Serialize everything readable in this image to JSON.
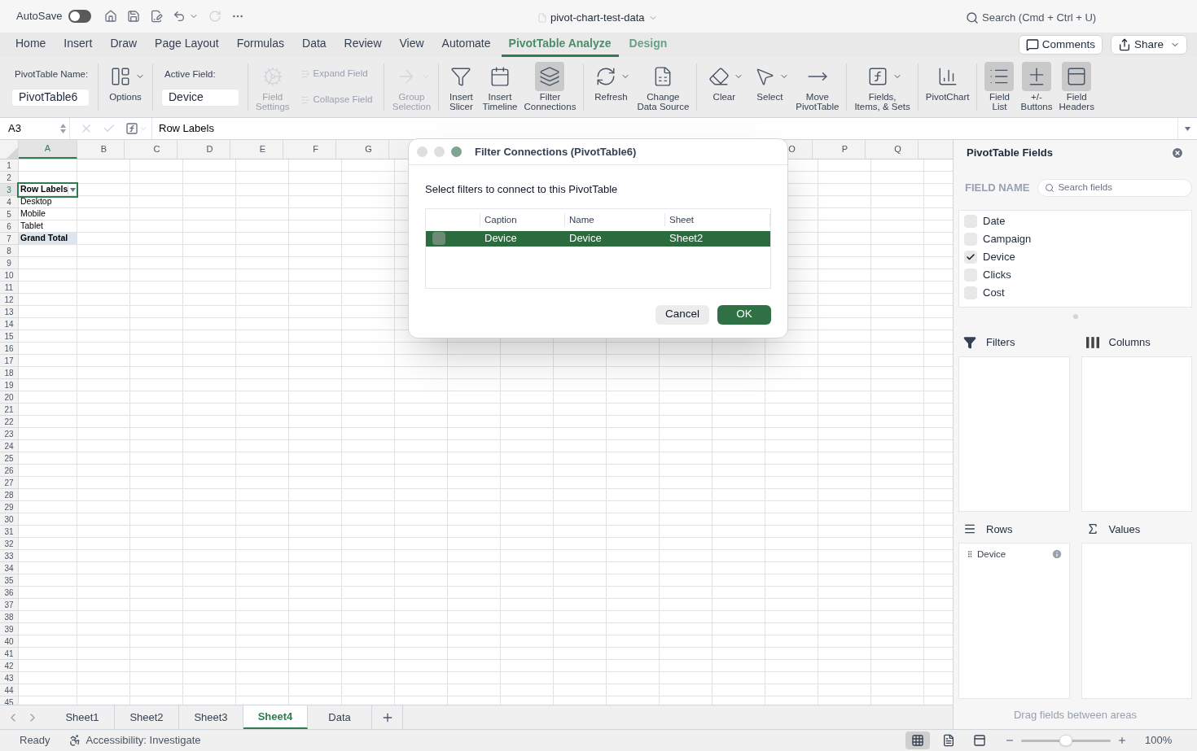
{
  "title_bar": {
    "autosave_label": "AutoSave",
    "autosave_on": false,
    "document_title": "pivot-chart-test-data",
    "search_placeholder": "Search (Cmd + Ctrl + U)"
  },
  "ribbon_tabs": [
    {
      "label": "Home",
      "selected": false,
      "contextual": false
    },
    {
      "label": "Insert",
      "selected": false,
      "contextual": false
    },
    {
      "label": "Draw",
      "selected": false,
      "contextual": false
    },
    {
      "label": "Page Layout",
      "selected": false,
      "contextual": false
    },
    {
      "label": "Formulas",
      "selected": false,
      "contextual": false
    },
    {
      "label": "Data",
      "selected": false,
      "contextual": false
    },
    {
      "label": "Review",
      "selected": false,
      "contextual": false
    },
    {
      "label": "View",
      "selected": false,
      "contextual": false
    },
    {
      "label": "Automate",
      "selected": false,
      "contextual": false
    },
    {
      "label": "PivotTable Analyze",
      "selected": true,
      "contextual": true
    },
    {
      "label": "Design",
      "selected": false,
      "contextual": true
    }
  ],
  "header_buttons": [
    "Comments",
    "Share"
  ],
  "ribbon_groups": [
    {
      "kind": "field",
      "label": "PivotTable Name:",
      "value": "PivotTable6"
    },
    {
      "kind": "buttons",
      "buttons": [
        {
          "kind": "large",
          "label": "Options",
          "caret": true,
          "disabled": false,
          "pressed": false
        }
      ]
    },
    {
      "kind": "field",
      "label": "Active Field:",
      "value": "Device"
    },
    {
      "kind": "buttons",
      "buttons": [
        {
          "kind": "large",
          "label": "Field\nSettings",
          "caret": false,
          "disabled": true,
          "pressed": false
        },
        {
          "kind": "small",
          "label": "Expand Field",
          "disabled": true
        },
        {
          "kind": "small",
          "label": "Collapse Field",
          "disabled": true
        }
      ]
    },
    {
      "kind": "buttons",
      "buttons": [
        {
          "kind": "large",
          "label": "Group\nSelection",
          "caret": true,
          "disabled": true,
          "pressed": false
        }
      ]
    },
    {
      "kind": "buttons",
      "buttons": [
        {
          "kind": "large",
          "label": "Insert\nSlicer",
          "caret": false,
          "disabled": false,
          "pressed": false
        },
        {
          "kind": "large",
          "label": "Insert\nTimeline",
          "caret": false,
          "disabled": false,
          "pressed": false
        },
        {
          "kind": "large",
          "label": "Filter\nConnections",
          "caret": false,
          "disabled": false,
          "pressed": true
        }
      ]
    },
    {
      "kind": "buttons",
      "buttons": [
        {
          "kind": "large",
          "label": "Refresh",
          "caret": true,
          "disabled": false,
          "pressed": false
        },
        {
          "kind": "large",
          "label": "Change\nData Source",
          "caret": false,
          "disabled": false,
          "pressed": false
        }
      ]
    },
    {
      "kind": "buttons",
      "buttons": [
        {
          "kind": "large",
          "label": "Clear",
          "caret": true,
          "disabled": false,
          "pressed": false
        },
        {
          "kind": "large",
          "label": "Select",
          "caret": true,
          "disabled": false,
          "pressed": false
        },
        {
          "kind": "large",
          "label": "Move\nPivotTable",
          "caret": false,
          "disabled": false,
          "pressed": false
        }
      ]
    },
    {
      "kind": "buttons",
      "buttons": [
        {
          "kind": "large",
          "label": "Fields,\nItems, & Sets",
          "caret": true,
          "disabled": false,
          "pressed": false
        }
      ]
    },
    {
      "kind": "buttons",
      "buttons": [
        {
          "kind": "large",
          "label": "PivotChart",
          "caret": false,
          "disabled": false,
          "pressed": false
        }
      ]
    },
    {
      "kind": "buttons",
      "buttons": [
        {
          "kind": "large",
          "label": "Field\nList",
          "caret": false,
          "disabled": false,
          "pressed": true
        },
        {
          "kind": "large",
          "label": "+/-\nButtons",
          "caret": false,
          "disabled": false,
          "pressed": true
        },
        {
          "kind": "large",
          "label": "Field\nHeaders",
          "caret": false,
          "disabled": false,
          "pressed": true
        }
      ]
    }
  ],
  "formula_bar": {
    "name_box": "A3",
    "formula": "Row Labels"
  },
  "sheet": {
    "columns_left": [
      {
        "label": "A",
        "selected": true
      },
      {
        "label": "B",
        "selected": false
      },
      {
        "label": "C",
        "selected": false
      },
      {
        "label": "D",
        "selected": false
      },
      {
        "label": "E",
        "selected": false
      },
      {
        "label": "F",
        "selected": false
      },
      {
        "label": "G",
        "selected": false
      }
    ],
    "columns_right": [
      {
        "label": "O",
        "selected": false
      },
      {
        "label": "P",
        "selected": false
      },
      {
        "label": "Q",
        "selected": false
      }
    ],
    "rows": [
      {
        "label": "1",
        "selected": false
      },
      {
        "label": "2",
        "selected": false
      },
      {
        "label": "3",
        "selected": true
      },
      {
        "label": "4",
        "selected": false
      },
      {
        "label": "5",
        "selected": false
      },
      {
        "label": "6",
        "selected": false
      },
      {
        "label": "7",
        "selected": false
      },
      {
        "label": "8",
        "selected": false
      },
      {
        "label": "9",
        "selected": false
      },
      {
        "label": "10",
        "selected": false
      },
      {
        "label": "11",
        "selected": false
      },
      {
        "label": "12",
        "selected": false
      },
      {
        "label": "13",
        "selected": false
      },
      {
        "label": "14",
        "selected": false
      },
      {
        "label": "15",
        "selected": false
      },
      {
        "label": "16",
        "selected": false
      },
      {
        "label": "17",
        "selected": false
      },
      {
        "label": "18",
        "selected": false
      },
      {
        "label": "19",
        "selected": false
      },
      {
        "label": "20",
        "selected": false
      },
      {
        "label": "21",
        "selected": false
      },
      {
        "label": "22",
        "selected": false
      },
      {
        "label": "23",
        "selected": false
      },
      {
        "label": "24",
        "selected": false
      },
      {
        "label": "25",
        "selected": false
      },
      {
        "label": "26",
        "selected": false
      },
      {
        "label": "27",
        "selected": false
      },
      {
        "label": "28",
        "selected": false
      },
      {
        "label": "29",
        "selected": false
      },
      {
        "label": "30",
        "selected": false
      },
      {
        "label": "31",
        "selected": false
      },
      {
        "label": "32",
        "selected": false
      },
      {
        "label": "33",
        "selected": false
      },
      {
        "label": "34",
        "selected": false
      },
      {
        "label": "35",
        "selected": false
      },
      {
        "label": "36",
        "selected": false
      },
      {
        "label": "37",
        "selected": false
      },
      {
        "label": "38",
        "selected": false
      },
      {
        "label": "39",
        "selected": false
      },
      {
        "label": "40",
        "selected": false
      },
      {
        "label": "41",
        "selected": false
      },
      {
        "label": "42",
        "selected": false
      },
      {
        "label": "43",
        "selected": false
      },
      {
        "label": "44",
        "selected": false
      },
      {
        "label": "45",
        "selected": false
      }
    ],
    "pivot_cells": [
      {
        "text": "Row Labels",
        "kind": "header",
        "selected": true
      },
      {
        "text": "Desktop",
        "kind": "item",
        "selected": false
      },
      {
        "text": "Mobile",
        "kind": "item",
        "selected": false
      },
      {
        "text": "Tablet",
        "kind": "item",
        "selected": false
      },
      {
        "text": "Grand Total",
        "kind": "total",
        "selected": false
      }
    ]
  },
  "sheet_tabs": [
    {
      "label": "Sheet1",
      "selected": false
    },
    {
      "label": "Sheet2",
      "selected": false
    },
    {
      "label": "Sheet3",
      "selected": false
    },
    {
      "label": "Sheet4",
      "selected": true
    },
    {
      "label": "Data",
      "selected": false
    }
  ],
  "status_bar": {
    "status": "Ready",
    "accessibility": "Accessibility: Investigate",
    "views": [
      {
        "kind": "normal",
        "selected": true
      },
      {
        "kind": "page_layout",
        "selected": false
      },
      {
        "kind": "page_break",
        "selected": false
      }
    ],
    "zoom": {
      "level": 0.5,
      "reading": "100%"
    }
  },
  "dialog": {
    "title": "Filter Connections (PivotTable6)",
    "prompt": "Select filters to connect to this PivotTable",
    "columns": [
      "Caption",
      "Name",
      "Sheet"
    ],
    "rows": [
      {
        "checked": false,
        "selected": true,
        "cells": [
          "Device",
          "Device",
          "Sheet2"
        ]
      }
    ],
    "buttons": [
      {
        "label": "Cancel",
        "kind": "secondary"
      },
      {
        "label": "OK",
        "kind": "primary"
      }
    ]
  },
  "field_panel": {
    "title": "PivotTable Fields",
    "field_name_label": "FIELD NAME",
    "search_placeholder": "Search fields",
    "fields": [
      {
        "label": "Date",
        "checked": false
      },
      {
        "label": "Campaign",
        "checked": false
      },
      {
        "label": "Device",
        "checked": true
      },
      {
        "label": "Clicks",
        "checked": false
      },
      {
        "label": "Cost",
        "checked": false
      }
    ],
    "areas": [
      {
        "kind": "filters",
        "label": "Filters"
      },
      {
        "kind": "columns",
        "label": "Columns"
      },
      {
        "kind": "rows",
        "label": "Rows",
        "items": [
          "Device"
        ]
      },
      {
        "kind": "values",
        "label": "Values"
      }
    ],
    "footer": "Drag fields between areas"
  }
}
